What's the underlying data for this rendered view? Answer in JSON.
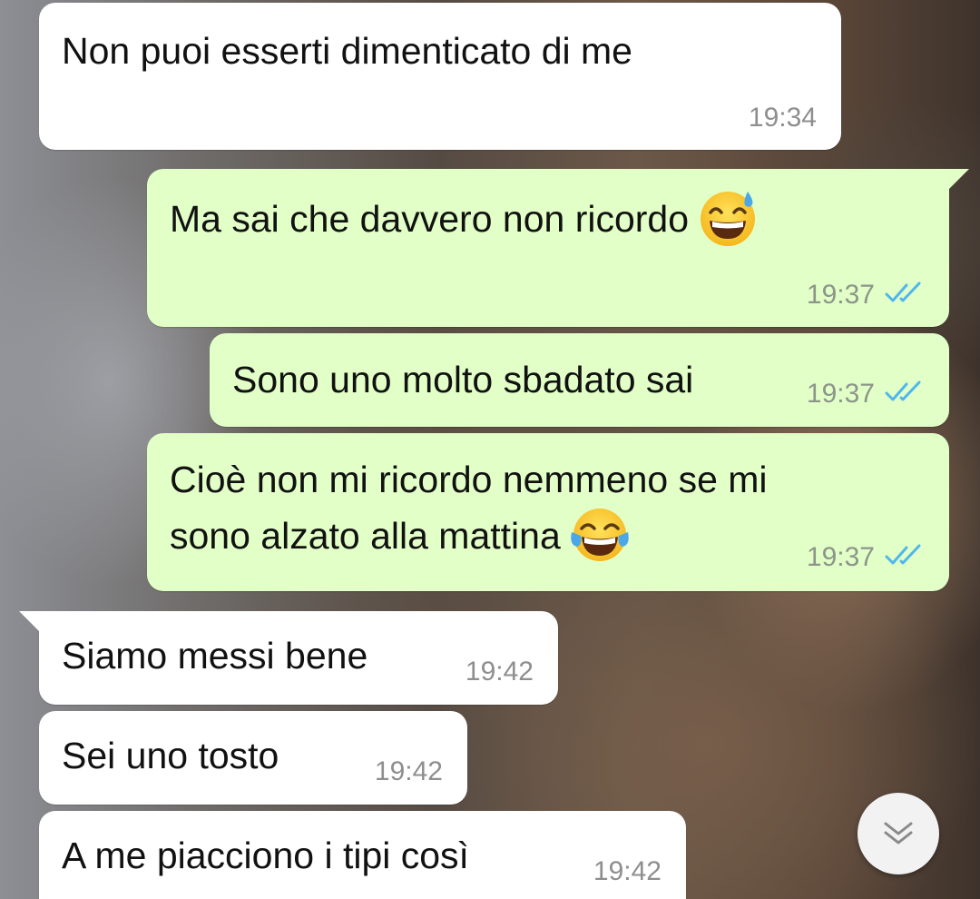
{
  "messages": [
    {
      "direction": "in",
      "text": "Non puoi esserti dimenticato di me",
      "time": "19:34"
    },
    {
      "direction": "out",
      "text": "Ma sai che davvero non ricordo",
      "time": "19:37",
      "emoji": "grinning-sweat-emoji",
      "status": "read"
    },
    {
      "direction": "out",
      "text": "Sono uno molto sbadato sai",
      "time": "19:37",
      "status": "read"
    },
    {
      "direction": "out",
      "lines": [
        "Cioè non mi ricordo nemmeno se mi",
        "sono alzato alla mattina"
      ],
      "time": "19:37",
      "emoji": "tears-of-joy-emoji",
      "status": "read"
    },
    {
      "direction": "in",
      "text": "Siamo messi bene",
      "time": "19:42"
    },
    {
      "direction": "in",
      "text": "Sei uno tosto",
      "time": "19:42"
    },
    {
      "direction": "in",
      "text": "A me piacciono i tipi così",
      "time": "19:42"
    }
  ],
  "scroll_button": {
    "icon": "double-chevron-down-icon"
  },
  "colors": {
    "incoming_bubble": "#ffffff",
    "outgoing_bubble": "#e2ffc8",
    "read_ticks": "#4fb6ec",
    "timestamp": "#8e8e8e"
  }
}
